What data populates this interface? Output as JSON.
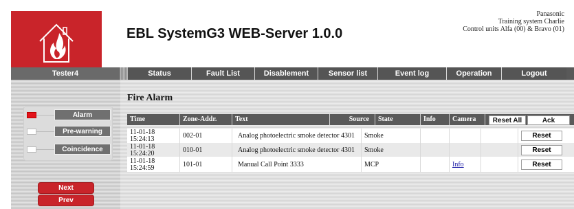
{
  "header": {
    "title": "EBL SystemG3 WEB-Server 1.0.0",
    "info_lines": [
      "Panasonic",
      "Training system Charlie",
      "Control units Alfa (00) & Bravo (01)"
    ],
    "logo_icon": "house-flame-logo"
  },
  "nav": {
    "user": "Tester4",
    "tabs": [
      "Status",
      "Fault List",
      "Disablement",
      "Sensor list",
      "Event log",
      "Operation",
      "Logout"
    ]
  },
  "sidebar": {
    "indicators": [
      {
        "label": "Alarm",
        "active": true
      },
      {
        "label": "Pre-warning",
        "active": false
      },
      {
        "label": "Coincidence",
        "active": false
      }
    ],
    "next_label": "Next",
    "prev_label": "Prev"
  },
  "main": {
    "title": "Fire Alarm",
    "columns": [
      "Time",
      "Zone-Addr.",
      "Text",
      "Source",
      "State",
      "Info",
      "Camera"
    ],
    "reset_all_label": "Reset All",
    "ack_label": "Ack",
    "reset_label": "Reset",
    "rows": [
      {
        "time": "11-01-18 15:24:13",
        "zone": "002-01",
        "text": "Analog photoelectric smoke detector 4301",
        "state": "Smoke",
        "info": ""
      },
      {
        "time": "11-01-18 15:24:20",
        "zone": "010-01",
        "text": "Analog photoelectric smoke detector 4301",
        "state": "Smoke",
        "info": ""
      },
      {
        "time": "11-01-18 15:24:59",
        "zone": "101-01",
        "text": "Manual Call Point 3333",
        "state": "MCP",
        "info": "Info"
      }
    ]
  },
  "colors": {
    "brand_red": "#c9242a",
    "nav_gray": "#595959",
    "indicator_active": "#e2131b"
  }
}
